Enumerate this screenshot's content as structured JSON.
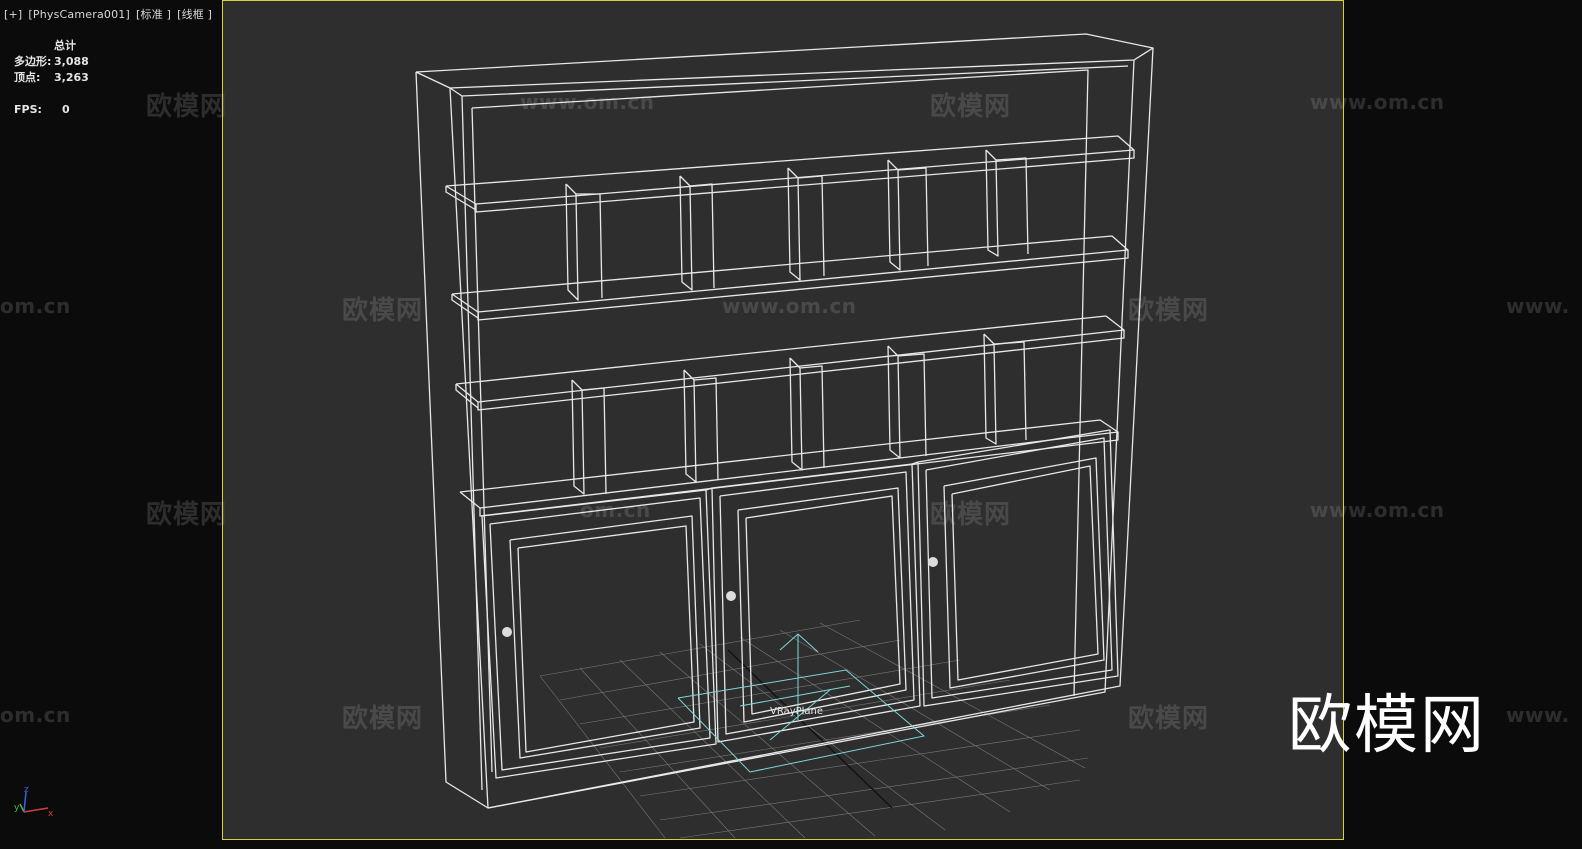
{
  "viewport": {
    "label_parts": [
      "[+]",
      "[PhysCamera001]",
      "[标准 ]",
      "[线框 ]"
    ],
    "border_color": "#d8d23a",
    "background": "#2e2e2e"
  },
  "stats": {
    "header": "总计",
    "polygons_label": "多边形:",
    "polygons_value": "3,088",
    "vertices_label": "顶点:",
    "vertices_value": "3,263",
    "fps_label": "FPS:",
    "fps_value": "0"
  },
  "gizmo": {
    "label": "VRayPlane",
    "color": "#7fd6d6"
  },
  "axis_tripod": {
    "x_label": "x",
    "y_label": "y",
    "z_label": "z",
    "x_color": "#d04040",
    "y_color": "#40c040",
    "z_color": "#4060e0"
  },
  "watermarks": {
    "brand": "欧模网",
    "url": "www.om.cn",
    "url_partial_left": "om.cn",
    "url_partial_right": "www.",
    "url_partial_mid": "om.cn"
  },
  "logo": {
    "text": "欧模网"
  },
  "model": {
    "wire_color": "#e8e8e8",
    "grid_color": "#8a8a8a"
  }
}
